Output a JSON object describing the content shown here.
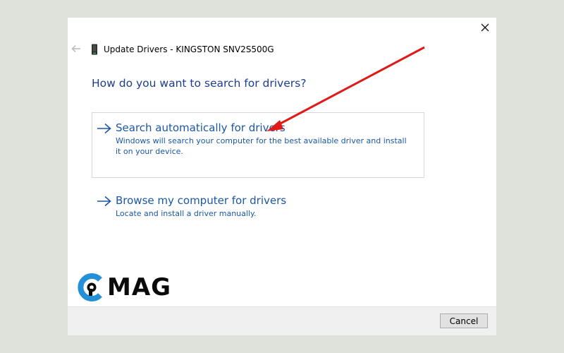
{
  "dialog": {
    "title": "Update Drivers - KINGSTON SNV2S500G",
    "question": "How do you want to search for drivers?",
    "options": [
      {
        "title": "Search automatically for drivers",
        "description": "Windows will search your computer for the best available driver and install it on your device."
      },
      {
        "title": "Browse my computer for drivers",
        "description": "Locate and install a driver manually."
      }
    ],
    "cancel_label": "Cancel"
  },
  "watermark": {
    "text": "MAG",
    "brand_color": "#2490d8"
  },
  "annotation": {
    "arrow_color": "#e01919"
  },
  "icons": {
    "close": "close-icon",
    "back": "back-arrow-icon",
    "device": "drive-device-icon",
    "option_arrow": "arrow-right-icon"
  }
}
